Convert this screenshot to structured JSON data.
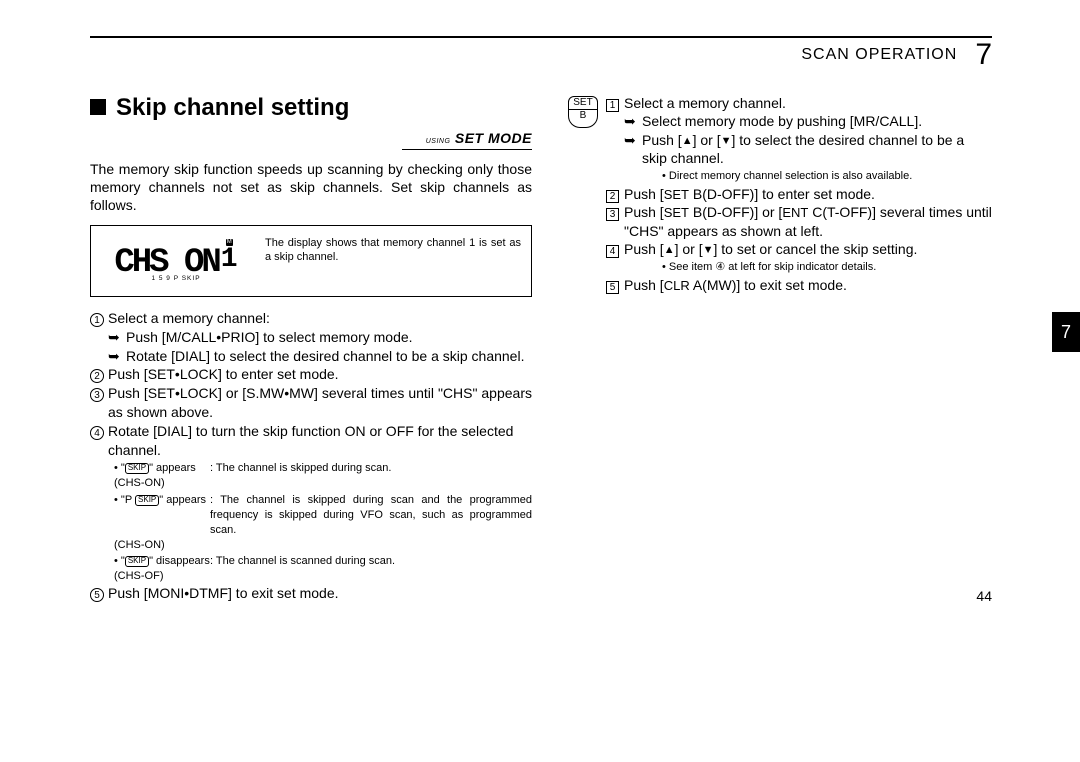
{
  "header": {
    "section": "SCAN OPERATION",
    "chapter_num": "7"
  },
  "title": "Skip channel setting",
  "setmode": {
    "using": "USING",
    "label": "SET MODE"
  },
  "intro": "The memory skip function speeds up scanning by checking only those memory channels not set as skip channels. Set skip channels as follows.",
  "display": {
    "big": "CHS ON",
    "big_right_small": "1",
    "m_badge": "M",
    "subrow": "1   5   9   P SKIP",
    "desc": "The display shows that memory channel 1 is set as a skip channel."
  },
  "left_steps": {
    "s1": "Select a memory channel:",
    "s1a": "Push [M/CALL•PRIO] to select memory mode.",
    "s1b": "Rotate [DIAL] to select the desired channel to be a skip channel.",
    "s2": "Push [SET•LOCK] to enter set mode.",
    "s3": "Push [SET•LOCK] or [S.MW•MW] several times until \"CHS\" appears as shown above.",
    "s4": "Rotate [DIAL] to turn the skip function ON or OFF for the selected channel.",
    "n1a": "\"",
    "n1b": "\" appears",
    "n1c": ": The channel is skipped during scan.",
    "n1d": "(CHS-ON)",
    "n2a": "\"P ",
    "n2b": "\" appears",
    "n2c": ": The channel is skipped during scan and the programmed frequency is skipped during VFO scan, such as programmed scan.",
    "n2d": "(CHS-ON)",
    "n3a": "\"",
    "n3b": "\" disappears",
    "n3c": ": The channel is scanned during scan.",
    "n3d": "(CHS-OF)",
    "skip_glyph": "SKIP",
    "s5": "Push [MONI•DTMF] to exit set mode."
  },
  "right_steps": {
    "label_top": "SET",
    "label_bot": "B",
    "s1": "Select a memory channel.",
    "s1a": "Select memory mode by pushing [MR/CALL].",
    "s1b_pre": "Push [",
    "s1b_mid": "] or [",
    "s1b_post": "] to select the desired channel to be a skip channel.",
    "s1note": "Direct memory channel selection is also available.",
    "s2_pre": "Push [",
    "s2_set": "SET",
    "s2_post": " B(D-OFF)] to enter set mode.",
    "s3_pre": "Push [",
    "s3_set": "SET",
    "s3_mid": " B(D-OFF)] or [",
    "s3_ent": "ENT",
    "s3_post": " C(T-OFF)] several times until \"CHS\" appears as shown at left.",
    "s4_pre": "Push [",
    "s4_mid": "] or [",
    "s4_post": "] to set or cancel the skip setting.",
    "s4note": "See item ④ at left for skip indicator details.",
    "s5_pre": "Push [",
    "s5_clr": "CLR",
    "s5_post": " A(MW)] to exit set mode."
  },
  "page_num": "44",
  "thumb": "7"
}
